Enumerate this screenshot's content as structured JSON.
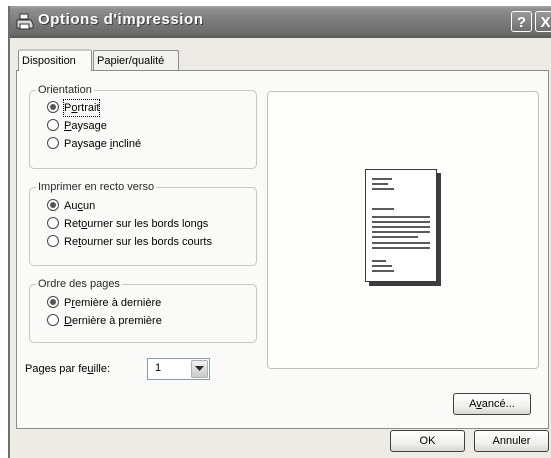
{
  "window": {
    "title": "Options d'impression",
    "help_label": "?",
    "close_label": "X"
  },
  "tabs": [
    {
      "label": "Disposition"
    },
    {
      "label": "Papier/qualité"
    }
  ],
  "orientation": {
    "title": "Orientation",
    "options": [
      {
        "pre": "P",
        "acc": "o",
        "post": "rtrait",
        "checked": true
      },
      {
        "pre": "",
        "acc": "P",
        "post": "aysage",
        "checked": false
      },
      {
        "pre": "Paysage ",
        "acc": "i",
        "post": "ncliné",
        "checked": false
      }
    ]
  },
  "duplex": {
    "title": "Imprimer en recto verso",
    "options": [
      {
        "pre": "Au",
        "acc": "c",
        "post": "un",
        "checked": true
      },
      {
        "pre": "Ret",
        "acc": "o",
        "post": "urner sur les bords longs",
        "checked": false
      },
      {
        "pre": "Re",
        "acc": "t",
        "post": "ourner sur les bords courts",
        "checked": false
      }
    ]
  },
  "page_order": {
    "title": "Ordre des pages",
    "options": [
      {
        "pre": "P",
        "acc": "r",
        "post": "emière à dernière",
        "checked": true
      },
      {
        "pre": "",
        "acc": "D",
        "post": "ernière à première",
        "checked": false
      }
    ]
  },
  "pages_per_sheet": {
    "pre": "Pages par fe",
    "acc": "u",
    "post": "ille:",
    "value": "1"
  },
  "buttons": {
    "advanced": {
      "pre": "A",
      "acc": "v",
      "post": "ancé..."
    },
    "ok": "OK",
    "cancel": "Annuler"
  }
}
